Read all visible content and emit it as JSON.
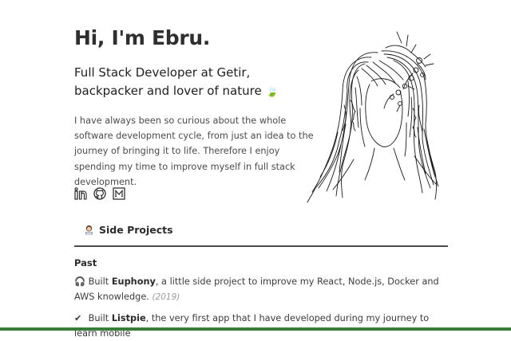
{
  "header": {
    "title": "Hi, I'm Ebru.",
    "subtitle": "Full Stack Developer at Getir, backpacker and lover of nature",
    "subtitle_emoji": "🍃",
    "intro": "I have always been so curious about the whole software development cycle, from just an idea to the journey of bringing it to life. Therefore I enjoy spending my time to improve myself in full stack development."
  },
  "socials": [
    {
      "name": "linkedin-icon",
      "glyph": "in"
    },
    {
      "name": "github-icon",
      "glyph": "◎"
    },
    {
      "name": "medium-icon",
      "glyph": "M"
    }
  ],
  "tabs": {
    "side_projects": {
      "label": "Side Projects",
      "icon": "woman-technologist-icon"
    }
  },
  "projects": {
    "past_label": "Past",
    "items": [
      {
        "icon": "🎧",
        "prefix": "Built ",
        "name": "Euphony",
        "text": ", a little side project to improve my React, Node.js, Docker and AWS knowledge.",
        "year": "(2019)"
      },
      {
        "icon": "✔",
        "prefix": "Built ",
        "name": "Listpie",
        "text": ", the very first app that I have developed during my journey to learn mobile",
        "year": ""
      }
    ]
  },
  "colors": {
    "accent_bar": "#3a7d3a",
    "tab_underline": "#4a4a4a",
    "leaf": "#6aa84f"
  }
}
